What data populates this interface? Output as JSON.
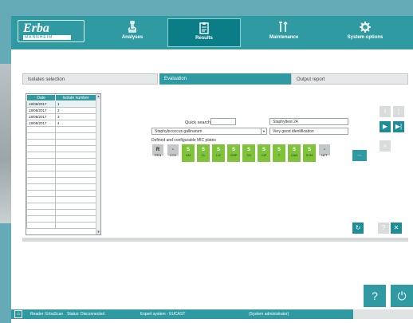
{
  "app": {
    "logo_text": "Erba",
    "logo_sub": "MANNHEIM"
  },
  "nav": {
    "tabs": [
      {
        "label": "Analyses",
        "icon": "microscope-icon"
      },
      {
        "label": "Results",
        "icon": "clipboard-icon"
      },
      {
        "label": "Maintenance",
        "icon": "tools-icon"
      },
      {
        "label": "System options",
        "icon": "gear-icon"
      }
    ],
    "active": "Results"
  },
  "breadcrumb": {
    "steps": [
      "Isolates selection",
      "Evaluation",
      "Output report"
    ],
    "active_step": "Evaluation"
  },
  "isolates_table": {
    "headers": [
      "Date",
      "Isolate number"
    ],
    "rows": [
      [
        "18/08/2017",
        "1"
      ],
      [
        "18/08/2017",
        "2"
      ],
      [
        "18/08/2017",
        "3"
      ],
      [
        "18/08/2017",
        "4"
      ]
    ],
    "selected_row": 0
  },
  "evaluation": {
    "quick_search_label": "Quick search",
    "quick_search_value": "",
    "strain_field": "Staphyltest 24",
    "organism_select": "Staphylococcus gallinarum",
    "identification_field": "Very good identification",
    "plates_label": "Defined and configurable MIC plates",
    "plates": [
      {
        "mark": "R",
        "name": "PEN",
        "color": "grey"
      },
      {
        "mark": "-",
        "name": "COX",
        "color": "grey"
      },
      {
        "mark": "S",
        "name": "AM",
        "color": "green"
      },
      {
        "mark": "S",
        "name": "CL",
        "color": "green"
      },
      {
        "mark": "S",
        "name": "LIZ",
        "color": "green"
      },
      {
        "mark": "S",
        "name": "CMP",
        "color": "green"
      },
      {
        "mark": "S",
        "name": "TEI",
        "color": "green"
      },
      {
        "mark": "S",
        "name": "CIP",
        "color": "green"
      },
      {
        "mark": "S",
        "name": "T",
        "color": "green"
      },
      {
        "mark": "S",
        "name": "CAN",
        "color": "green"
      },
      {
        "mark": "S",
        "name": "SXM",
        "color": "green"
      },
      {
        "mark": "-",
        "name": "NFT",
        "color": "grey"
      }
    ],
    "more_label": "..."
  },
  "status_bar": {
    "reader": "Reader: ErbaScan",
    "status": "Status: Disconnected",
    "expert": "Expert system - EUCAST",
    "user": "(System administrator)"
  },
  "colors": {
    "accent": "#2f9aa2",
    "green": "#7fc33a",
    "grey": "#c2c7c8"
  }
}
